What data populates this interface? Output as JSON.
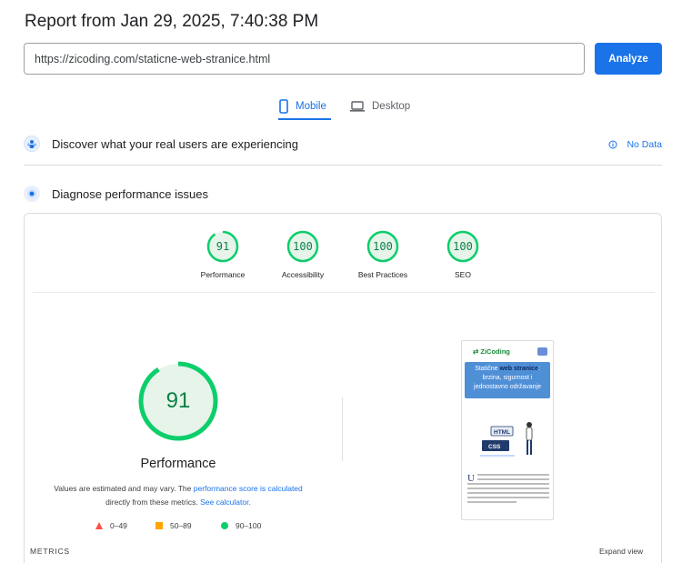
{
  "report": {
    "title": "Report from Jan 29, 2025, 7:40:38 PM"
  },
  "search": {
    "url": "https://zicoding.com/staticne-web-stranice.html",
    "analyze_label": "Analyze"
  },
  "tabs": [
    {
      "label": "Mobile",
      "active": true
    },
    {
      "label": "Desktop",
      "active": false
    }
  ],
  "crux": {
    "heading": "Discover what your real users are experiencing",
    "no_data_label": "No Data"
  },
  "diagnose": {
    "heading": "Diagnose performance issues"
  },
  "categories": [
    {
      "label": "Performance",
      "score": "91"
    },
    {
      "label": "Accessibility",
      "score": "100"
    },
    {
      "label": "Best Practices",
      "score": "100"
    },
    {
      "label": "SEO",
      "score": "100"
    }
  ],
  "main_gauge": {
    "score": "91",
    "label": "Performance"
  },
  "note": {
    "prefix": "Values are estimated and may vary. The ",
    "link1": "performance score is calculated",
    "middle": " directly from these metrics. ",
    "link2": "See calculator."
  },
  "legend": [
    {
      "label": "0–49"
    },
    {
      "label": "50–89"
    },
    {
      "label": "90–100"
    }
  ],
  "metrics_label": "METRICS",
  "expand_label": "Expand view",
  "preview": {
    "logo_text": "ZiCoding",
    "hero_line1": "Statične ",
    "hero_bold": "web stranice",
    "hero_line1_end": ":",
    "hero_line2": "brzina, sigurnost i",
    "hero_line3": "jednostavno održavanje",
    "illus_html": "HTML",
    "illus_css": "CSS",
    "body_initial": "U"
  },
  "colors": {
    "accent": "#1a73e8",
    "pass": "#0cce6b",
    "pass_text": "#0b8043",
    "average": "#ffa400",
    "fail": "#ff4e42"
  }
}
